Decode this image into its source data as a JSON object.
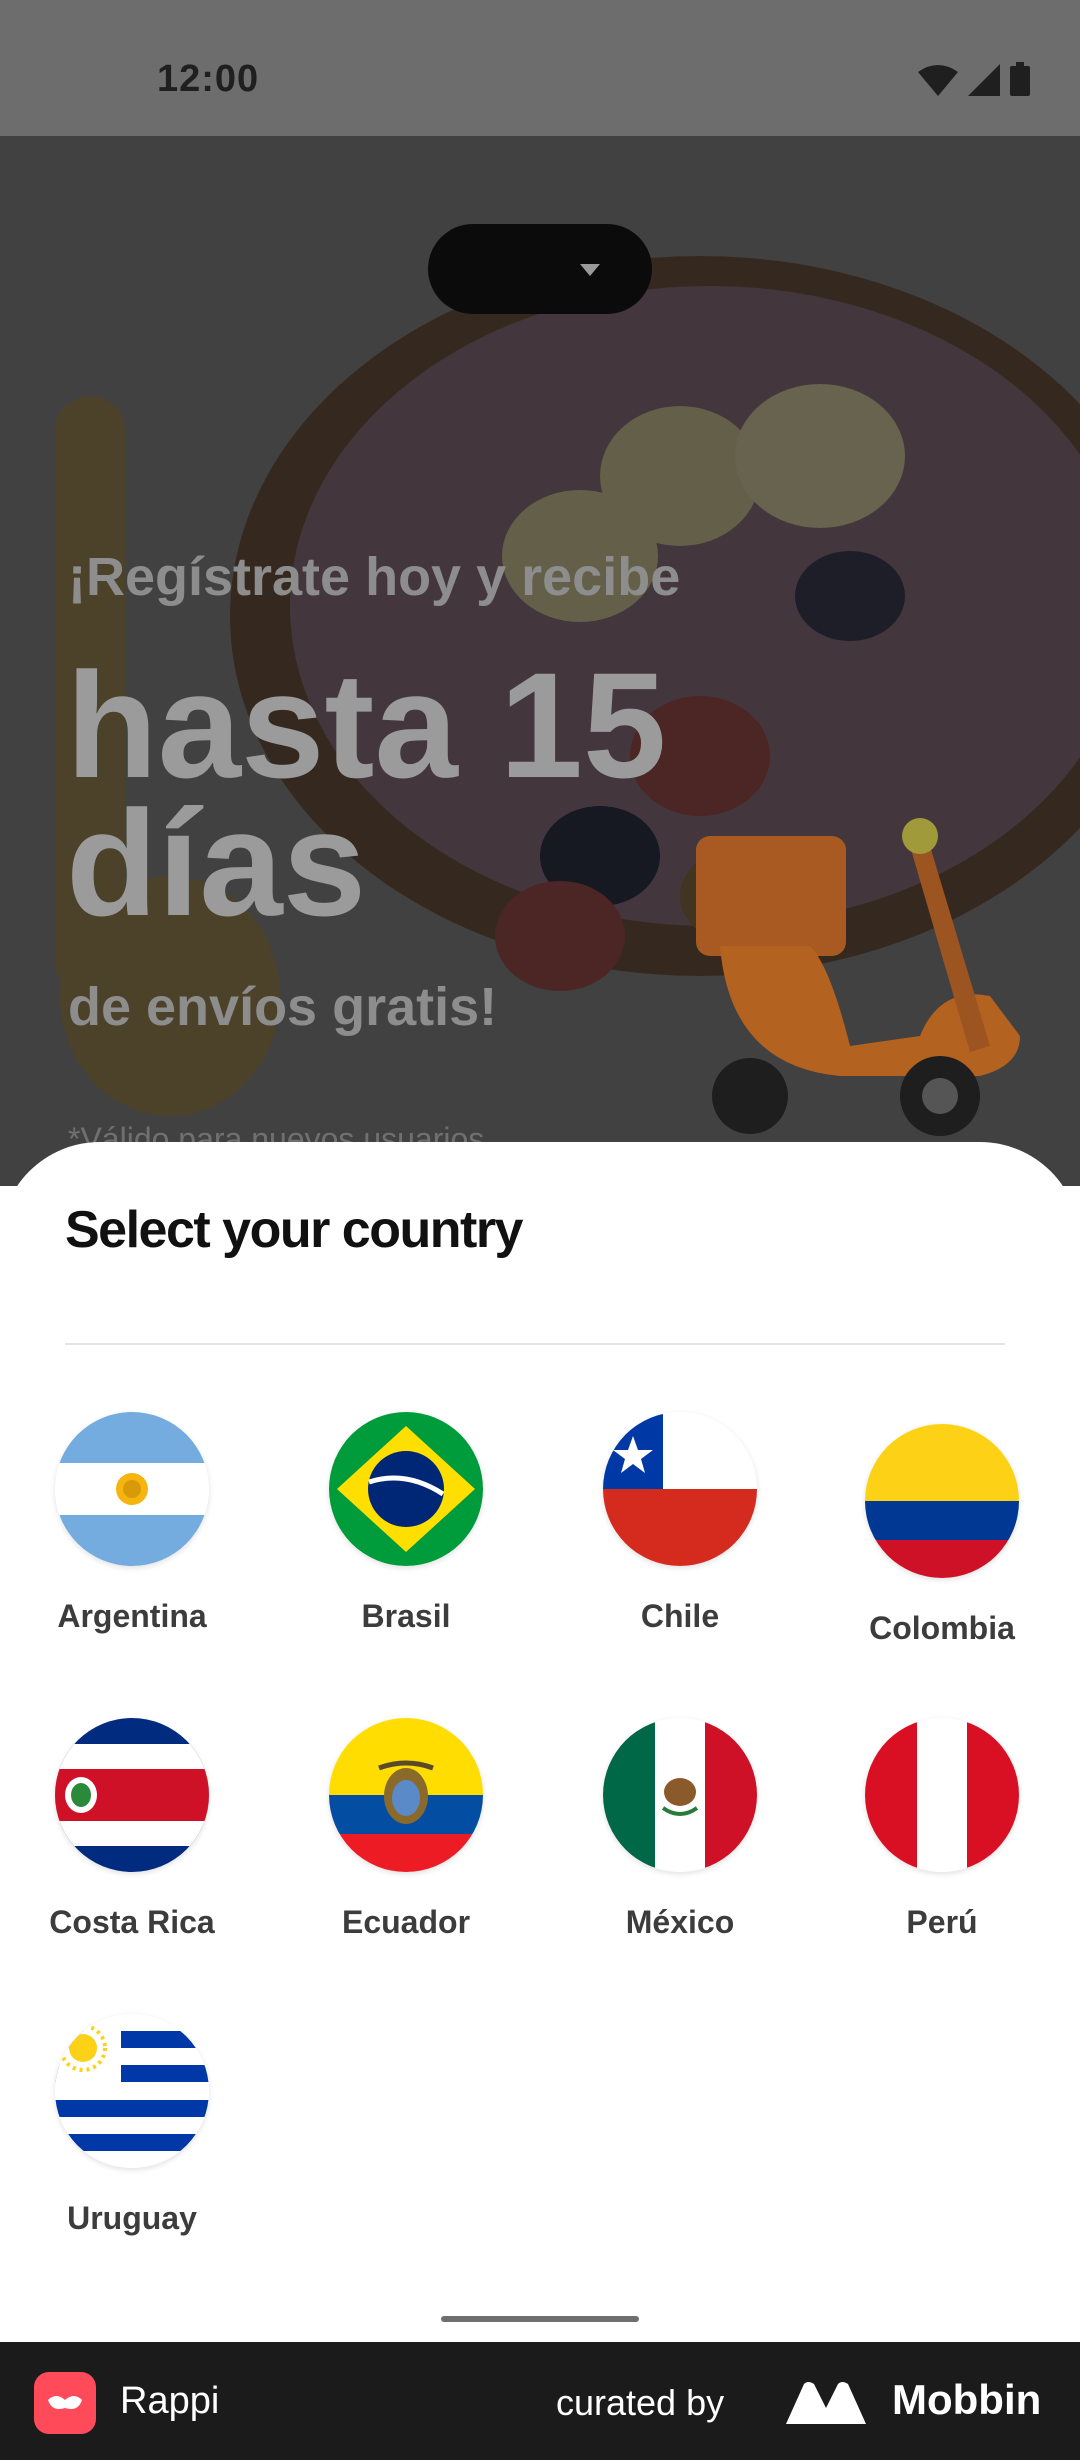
{
  "status_bar": {
    "time": "12:00",
    "icons": [
      "wifi-icon",
      "signal-icon",
      "battery-icon"
    ]
  },
  "hero": {
    "line1": "¡Regístrate hoy y recibe",
    "big": "hasta 15 días",
    "line3": "de envíos gratis!",
    "note": "*Válido para nuevos usuarios"
  },
  "sheet": {
    "title": "Select your country",
    "countries": [
      {
        "name": "Argentina"
      },
      {
        "name": "Brasil"
      },
      {
        "name": "Chile"
      },
      {
        "name": "Colombia"
      },
      {
        "name": "Costa Rica"
      },
      {
        "name": "Ecuador"
      },
      {
        "name": "México"
      },
      {
        "name": "Perú"
      },
      {
        "name": "Uruguay"
      }
    ]
  },
  "footer": {
    "app_name": "Rappi",
    "curated_by": "curated by",
    "brand": "Mobbin"
  },
  "colors": {
    "rappi_red": "#ff4a5a",
    "footer_bg": "#1b1b1b",
    "status_bar_bg": "#6d6d6d"
  }
}
